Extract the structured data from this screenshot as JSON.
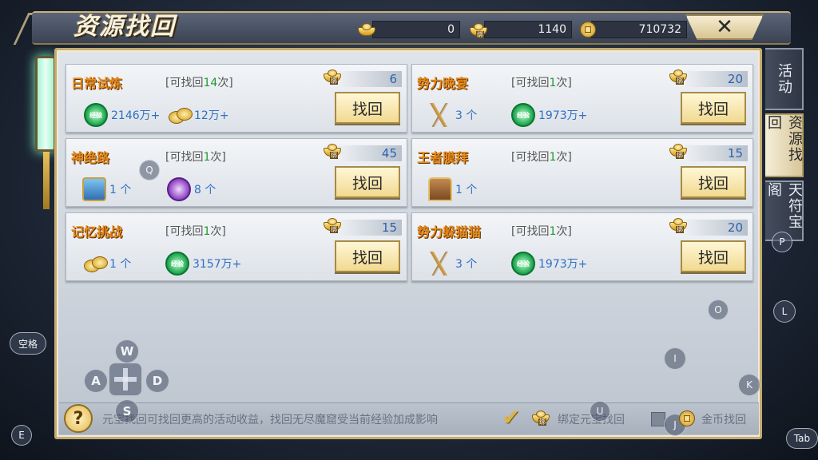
{
  "header": {
    "title": "资源找回",
    "currencies": [
      {
        "icon": "gold-ingot-icon",
        "value": "0"
      },
      {
        "icon": "bound-ingot-icon",
        "value": "1140"
      },
      {
        "icon": "copper-coin-icon",
        "value": "710732"
      }
    ],
    "close_label": "✕"
  },
  "tasks": [
    {
      "name": "日常试炼",
      "count_prefix": "[可找回",
      "count": "14",
      "count_suffix": "次]",
      "cost": "6",
      "button": "找回",
      "rewards": [
        {
          "icon": "exp-orb-icon",
          "text": "2146万+"
        },
        {
          "icon": "gold-coins-icon",
          "text": "12万+"
        }
      ]
    },
    {
      "name": "势力晚宴",
      "count_prefix": "[可找回",
      "count": "1",
      "count_suffix": "次]",
      "cost": "20",
      "button": "找回",
      "rewards": [
        {
          "icon": "ginseng-root-icon",
          "text": "3 个"
        },
        {
          "icon": "exp-orb-icon",
          "text": "1973万+"
        }
      ]
    },
    {
      "name": "神绝路",
      "count_prefix": "[可找回",
      "count": "1",
      "count_suffix": "次]",
      "cost": "45",
      "button": "找回",
      "rewards": [
        {
          "icon": "blue-chest-icon",
          "text": "1 个"
        },
        {
          "icon": "purple-orb-icon",
          "text": "8 个"
        }
      ]
    },
    {
      "name": "王者膜拜",
      "count_prefix": "[可找回",
      "count": "1",
      "count_suffix": "次]",
      "cost": "15",
      "button": "找回",
      "rewards": [
        {
          "icon": "treasure-chest-icon",
          "text": "1 个"
        }
      ]
    },
    {
      "name": "记忆挑战",
      "count_prefix": "[可找回",
      "count": "1",
      "count_suffix": "次]",
      "cost": "15",
      "button": "找回",
      "rewards": [
        {
          "icon": "gold-coins-icon",
          "text": "1 个"
        },
        {
          "icon": "exp-orb-icon",
          "text": "3157万+"
        }
      ]
    },
    {
      "name": "势力躲猫猫",
      "count_prefix": "[可找回",
      "count": "1",
      "count_suffix": "次]",
      "cost": "20",
      "button": "找回",
      "rewards": [
        {
          "icon": "ginseng-root-icon",
          "text": "3 个"
        },
        {
          "icon": "exp-orb-icon",
          "text": "1973万+"
        }
      ]
    }
  ],
  "icon_labels": {
    "exp": "经验",
    "bind": "绑"
  },
  "footer": {
    "help": "?",
    "note": "元宝找回可找回更高的活动收益，找回无尽魔窟受当前经验加成影响",
    "bind_option": "绑定元宝找回",
    "gold_option": "金币找回",
    "bind_checked": true,
    "gold_checked": false
  },
  "side_tabs": [
    {
      "label": "活动",
      "active": false
    },
    {
      "label": "资源找回",
      "active": true
    },
    {
      "label": "天符宝阁",
      "active": false
    }
  ],
  "key_hints": {
    "space": "空格",
    "e": "E",
    "tab": "Tab",
    "q": "Q",
    "w": "W",
    "a": "A",
    "s": "S",
    "d": "D",
    "p": "P",
    "o": "O",
    "l": "L",
    "i": "I",
    "k": "K",
    "u": "U",
    "j": "J"
  }
}
